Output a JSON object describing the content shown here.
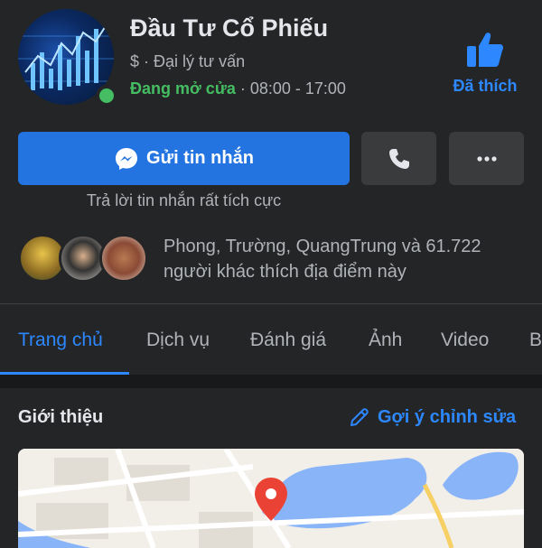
{
  "page": {
    "name": "Đầu Tư Cổ Phiếu",
    "category": "$ · Đại lý tư vấn",
    "status_open": "Đang mở cửa",
    "hours": " · 08:00 - 17:00",
    "liked_label": "Đã thích"
  },
  "actions": {
    "message_label": "Gửi tin nhắn",
    "reply_note": "Trả lời tin nhắn rất tích cực"
  },
  "friends": {
    "text_line1": "Phong, Trường, QuangTrung và 61.722",
    "text_line2": "người khác thích địa điểm này"
  },
  "tabs": [
    "Trang chủ",
    "Dịch vụ",
    "Đánh giá",
    "Ảnh",
    "Video",
    "B"
  ],
  "intro": {
    "title": "Giới thiệu",
    "suggest_edit": "Gợi ý chỉnh sửa"
  },
  "colors": {
    "accent": "#2d88ff",
    "button": "#2374e1",
    "online": "#45bd62",
    "background": "#242526"
  },
  "icons": [
    "like-thumb-icon",
    "messenger-icon",
    "phone-icon",
    "more-icon",
    "pencil-icon",
    "map-pin-icon"
  ]
}
